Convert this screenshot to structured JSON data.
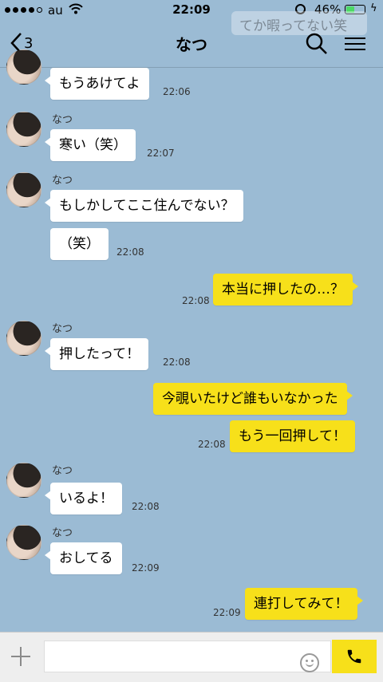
{
  "status": {
    "carrier": "au",
    "time": "22:09",
    "battery": "46%",
    "battery_level": 0.46
  },
  "header": {
    "back_count": "3",
    "title": "なつ",
    "banner": "てか暇ってない笑"
  },
  "messages": [
    {
      "sender": "なつ",
      "text": "もうあけてよ",
      "time": "22:06"
    },
    {
      "sender": "なつ",
      "text": "寒い（笑）",
      "time": "22:07"
    },
    {
      "sender": "なつ",
      "text": "もしかしてここ住んでない？",
      "time": ""
    },
    {
      "sender": "",
      "text": "（笑）",
      "time": "22:08"
    },
    {
      "sender": "me",
      "text": "本当に押したの…？",
      "time": "22:08"
    },
    {
      "sender": "なつ",
      "text": "押したって！",
      "time": "22:08"
    },
    {
      "sender": "me",
      "text": "今覗いたけど誰もいなかった",
      "time": ""
    },
    {
      "sender": "me",
      "text": "もう一回押して！",
      "time": "22:08"
    },
    {
      "sender": "なつ",
      "text": "いるよ！",
      "time": "22:08"
    },
    {
      "sender": "なつ",
      "text": "おしてる",
      "time": "22:09"
    },
    {
      "sender": "me",
      "text": "連打してみて！",
      "time": "22:09"
    }
  ],
  "colors": {
    "background": "#9bbbd4",
    "outgoing_bubble": "#f7e01a",
    "incoming_bubble": "#ffffff",
    "call_button": "#f7e01a"
  },
  "icons": {
    "back": "chevron-left-icon",
    "search": "search-icon",
    "menu": "hamburger-menu-icon",
    "add": "plus-icon",
    "emoji": "smiley-icon",
    "call": "phone-icon"
  }
}
